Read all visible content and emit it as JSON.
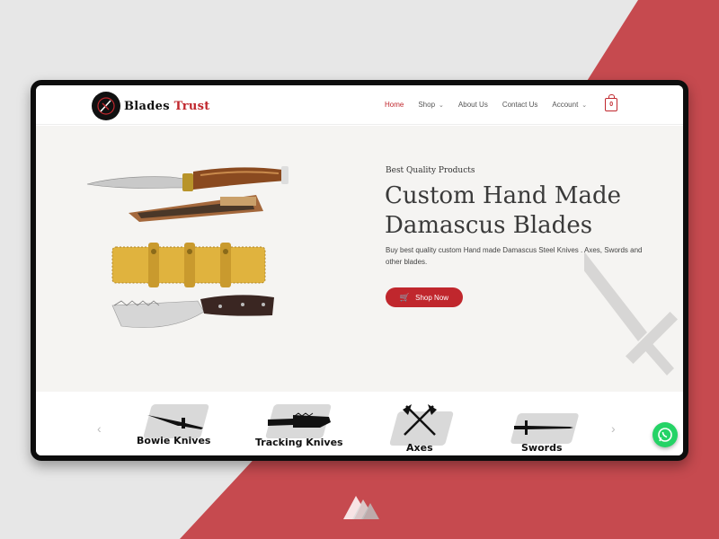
{
  "logo": {
    "word1": "Blades",
    "word2": "Trust"
  },
  "nav": {
    "items": [
      {
        "label": "Home",
        "active": true,
        "dropdown": false
      },
      {
        "label": "Shop",
        "active": false,
        "dropdown": true
      },
      {
        "label": "About Us",
        "active": false,
        "dropdown": false
      },
      {
        "label": "Contact Us",
        "active": false,
        "dropdown": false
      },
      {
        "label": "Account",
        "active": false,
        "dropdown": true
      }
    ],
    "cart_count": "0"
  },
  "hero": {
    "tagline": "Best Quality Products",
    "headline": "Custom Hand Made Damascus Blades",
    "description": "Buy best quality custom Hand made Damascus Steel Knives . Axes, Swords and other blades.",
    "cta_label": "Shop Now"
  },
  "categories": [
    {
      "label": "Bowie Knives",
      "icon": "bowie-knife-icon"
    },
    {
      "label": "Tracking Knives",
      "icon": "tracking-knife-icon"
    },
    {
      "label": "Axes",
      "icon": "crossed-axes-icon"
    },
    {
      "label": "Swords",
      "icon": "sword-icon"
    }
  ],
  "colors": {
    "accent": "#c0272d",
    "whatsapp": "#25d366",
    "background_red": "#c64a4f"
  }
}
